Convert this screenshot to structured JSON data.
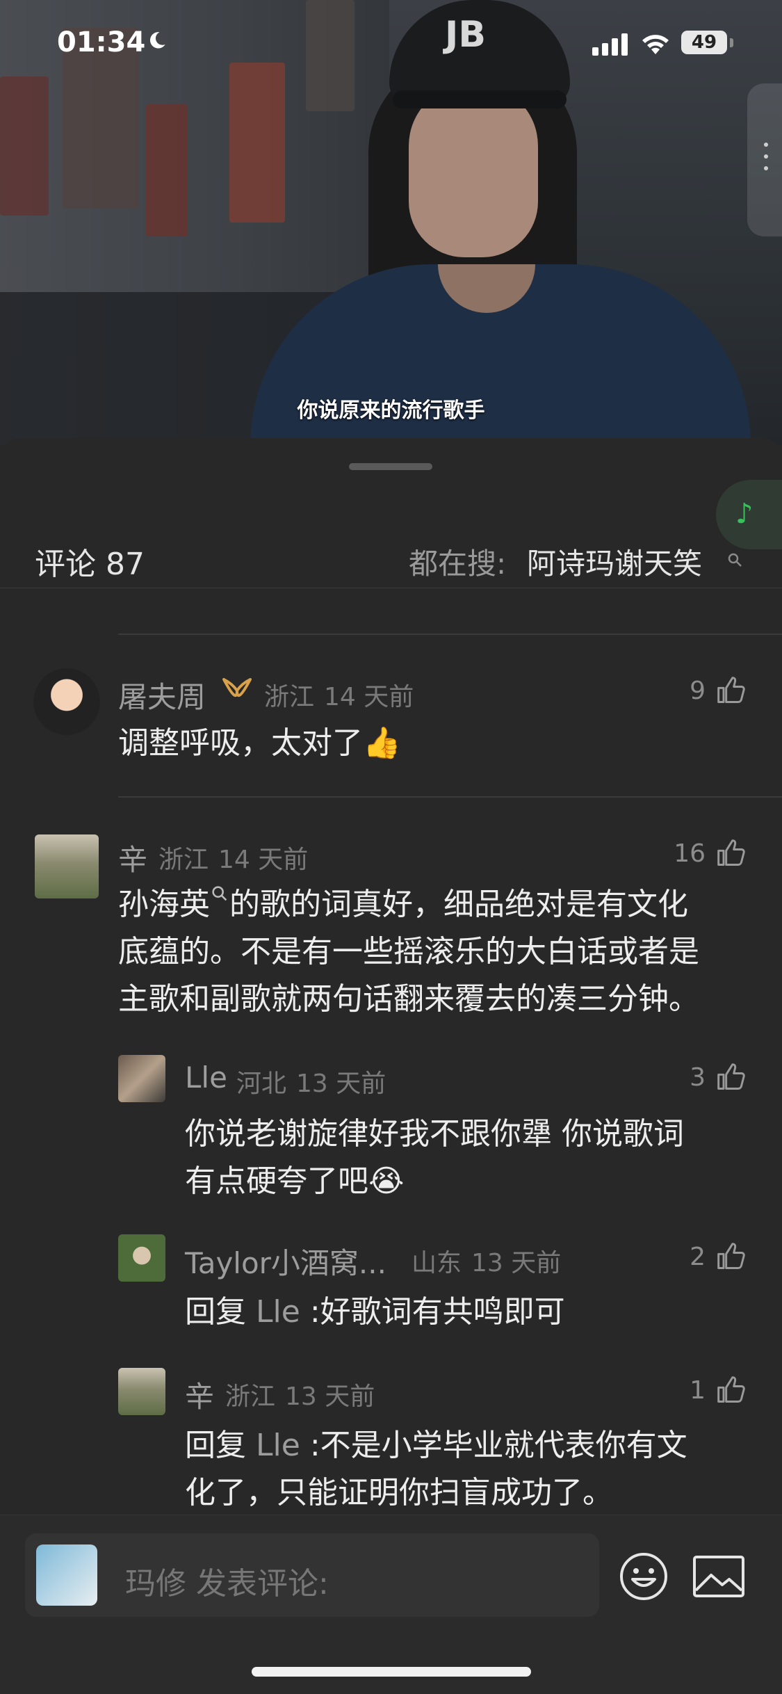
{
  "status_bar": {
    "time": "01:34",
    "battery": "49",
    "icons": [
      "moon-icon",
      "cellular-signal-icon",
      "wifi-icon",
      "battery-icon"
    ]
  },
  "video": {
    "subtitle": "你说原来的流行歌手",
    "cap_text": "JB"
  },
  "comments_header": {
    "title": "评论 87",
    "search_prefix": "都在搜:",
    "search_term": "阿诗玛谢天笑"
  },
  "comments": [
    {
      "username": "屠夫周",
      "location": "浙江",
      "time": "14 天前",
      "likes": "9",
      "text": "调整呼吸，太对了👍",
      "badge": "vip-badge-icon"
    },
    {
      "username": "辛",
      "location": "浙江",
      "time": "14 天前",
      "likes": "16",
      "text_part1": "孙海英",
      "text_part2": "的歌的词真好，细品绝对是有文化",
      "text_line2": "底蕴的。不是有一些摇滚乐的大白话或者是",
      "text_line3": "主歌和副歌就两句话翻来覆去的凑三分钟。",
      "replies": [
        {
          "username": "Lle",
          "location": "河北",
          "time": "13 天前",
          "likes": "3",
          "text_line1": "你说老谢旋律好我不跟你犟 你说歌词",
          "text_line2": "有点硬夸了吧😭"
        },
        {
          "username": "Taylor小酒窝...",
          "location": "山东",
          "time": "13 天前",
          "likes": "2",
          "reply_prefix": "回复",
          "reply_to": "Lle",
          "text": ":好歌词有共鸣即可"
        },
        {
          "username": "辛",
          "location": "浙江",
          "time": "13 天前",
          "likes": "1",
          "reply_prefix": "回复",
          "reply_to": "Lle",
          "text_line1": ":不是小学毕业就代表你有文",
          "text_line2": "化了，只能证明你扫盲成功了。"
        }
      ]
    }
  ],
  "composer": {
    "placeholder": "玛修 发表评论:"
  },
  "colors": {
    "background": "#282828",
    "accent_green": "#37c15a",
    "vip_gold": "#d9a24a"
  }
}
